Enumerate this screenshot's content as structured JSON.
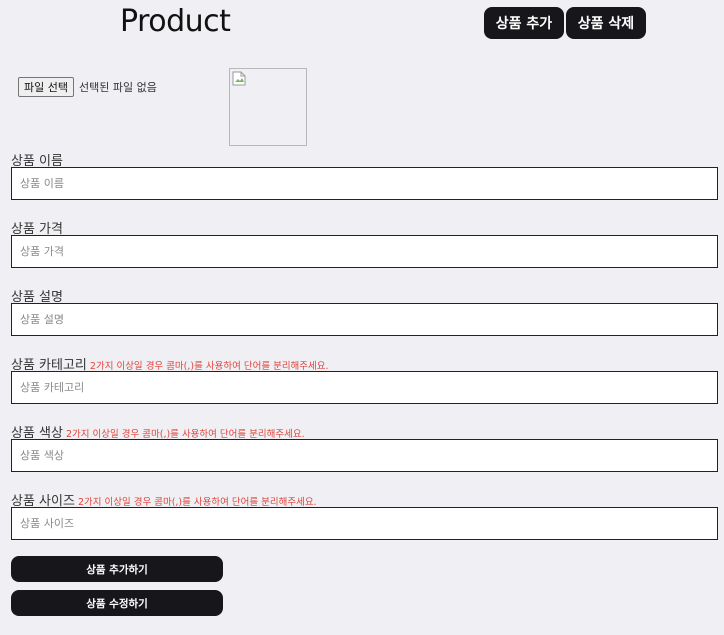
{
  "header": {
    "title": "Product",
    "add_button": "상품 추가",
    "delete_button": "상품 삭제"
  },
  "file_upload": {
    "button_label": "파일 선택",
    "status": "선택된 파일 없음"
  },
  "fields": [
    {
      "label": "상품 이름",
      "hint": "",
      "placeholder": "상품 이름",
      "value": ""
    },
    {
      "label": "상품 가격",
      "hint": "",
      "placeholder": "상품 가격",
      "value": ""
    },
    {
      "label": "상품 설명",
      "hint": "",
      "placeholder": "상품 설명",
      "value": ""
    },
    {
      "label": "상품 카테고리",
      "hint": "2가지 이상일 경우 콤마(,)를 사용하여 단어를 분리해주세요.",
      "placeholder": "상품 카테고리",
      "value": ""
    },
    {
      "label": "상품 색상",
      "hint": "2가지 이상일 경우 콤마(,)를 사용하여 단어를 분리해주세요.",
      "placeholder": "상품 색상",
      "value": ""
    },
    {
      "label": "상품 사이즈",
      "hint": "2가지 이상일 경우 콤마(,)를 사용하여 단어를 분리해주세요.",
      "placeholder": "상품 사이즈",
      "value": ""
    }
  ],
  "actions": {
    "submit_add": "상품 추가하기",
    "submit_edit": "상품 수정하기"
  },
  "colors": {
    "button_bg": "#17171b",
    "hint_text": "#e0443c",
    "page_bg": "#f0f0f4"
  }
}
